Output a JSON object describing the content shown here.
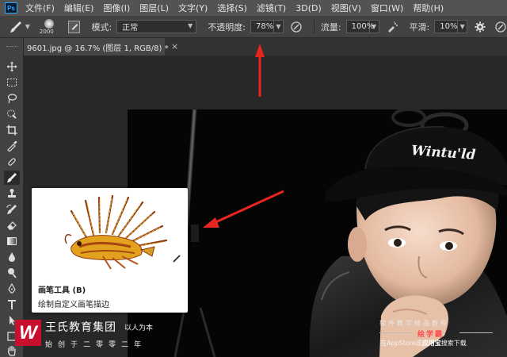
{
  "app": {
    "logo_text": "Ps",
    "accent": "#31a8ff"
  },
  "menu": [
    {
      "label": "文件(F)"
    },
    {
      "label": "编辑(E)"
    },
    {
      "label": "图像(I)"
    },
    {
      "label": "图层(L)"
    },
    {
      "label": "文字(Y)"
    },
    {
      "label": "选择(S)"
    },
    {
      "label": "滤镜(T)"
    },
    {
      "label": "3D(D)"
    },
    {
      "label": "视图(V)"
    },
    {
      "label": "窗口(W)"
    },
    {
      "label": "帮助(H)"
    }
  ],
  "options_bar": {
    "brush_size": "2000",
    "mode_label": "模式:",
    "mode_value": "正常",
    "opacity_label": "不透明度:",
    "opacity_value": "78%",
    "flow_label": "流量:",
    "flow_value": "100%",
    "smooth_label": "平滑:",
    "smooth_value": "10%"
  },
  "document": {
    "tab_title": "9601.jpg @ 16.7% (图层 1, RGB/8) *",
    "close_glyph": "×"
  },
  "tooltip": {
    "title": "画笔工具 (B)",
    "description": "绘制自定义画笔描边"
  },
  "photo": {
    "cap_text": "Wintu'ld"
  },
  "watermark": {
    "logo_letter": "W",
    "name": "王氏教育集团",
    "motto": "以人为本",
    "since": "始创于二零零二年",
    "right_line1": "软件教学精品教程",
    "right_line2": "绘学霸",
    "right_line3_a": "在AppStore或",
    "right_line3_b": "应用宝",
    "right_line3_c": "搜索下载",
    "brand_color": "#c8102e"
  },
  "annotation": {
    "arrow_color": "#e8251f"
  }
}
